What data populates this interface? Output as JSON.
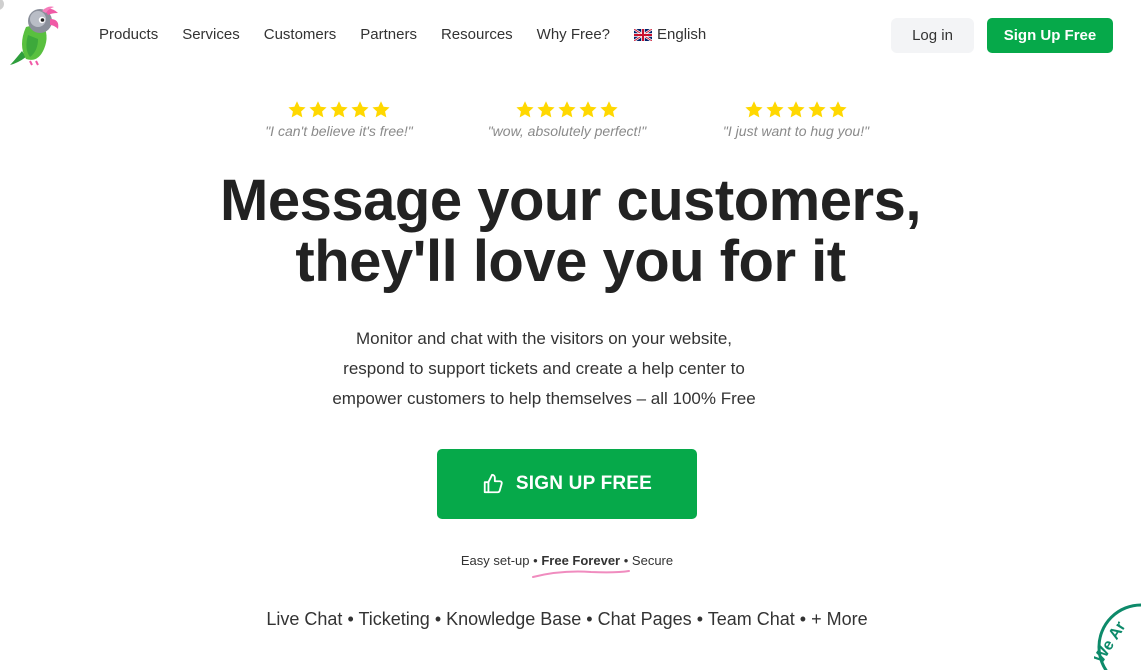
{
  "nav": {
    "items": [
      "Products",
      "Services",
      "Customers",
      "Partners",
      "Resources",
      "Why Free?"
    ],
    "language": "English"
  },
  "header": {
    "login_label": "Log in",
    "signup_label": "Sign Up Free"
  },
  "reviews": [
    {
      "stars": 5,
      "quote": "\"I can't believe it's free!\""
    },
    {
      "stars": 5,
      "quote": "\"wow, absolutely perfect!\""
    },
    {
      "stars": 5,
      "quote": "\"I just want to hug you!\""
    }
  ],
  "hero": {
    "headline_line1": "Message your customers,",
    "headline_line2": "they'll love you for it",
    "subtext_line1": "Monitor and chat with the visitors on your website,",
    "subtext_line2": "respond to support tickets and create a help center to",
    "subtext_line3": "empower customers to help themselves – all 100% Free",
    "cta_label": "SIGN UP FREE"
  },
  "perks": {
    "first": "Easy set-up",
    "highlight": "Free Forever",
    "last": "Secure",
    "separator": "•"
  },
  "features": {
    "items": [
      "Live Chat",
      "Ticketing",
      "Knowledge Base",
      "Chat Pages",
      "Team Chat",
      "+ More"
    ],
    "separator": "•"
  },
  "badge": {
    "partial_text": "We Ar"
  },
  "colors": {
    "brand_green": "#06a94a",
    "star_yellow": "#ffd800",
    "squiggle_pink": "#f08cbf",
    "login_bg": "#f3f4f6"
  },
  "icons": [
    "parrot-logo-icon",
    "uk-flag-icon",
    "star-icon",
    "thumbs-up-icon"
  ]
}
